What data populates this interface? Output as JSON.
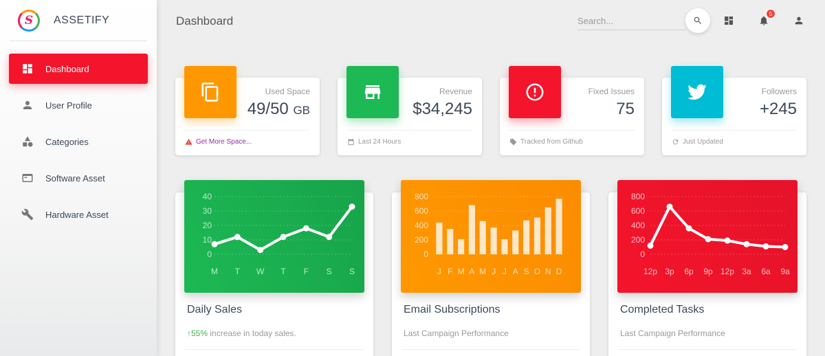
{
  "brand": {
    "name": "ASSETIFY",
    "logo_letter": "S"
  },
  "sidebar": {
    "items": [
      {
        "label": "Dashboard",
        "icon": "dashboard-icon",
        "active": true
      },
      {
        "label": "User Profile",
        "icon": "person-icon",
        "active": false
      },
      {
        "label": "Categories",
        "icon": "category-shapes-icon",
        "active": false
      },
      {
        "label": "Software Asset",
        "icon": "window-icon",
        "active": false
      },
      {
        "label": "Hardware Asset",
        "icon": "wrench-icon",
        "active": false
      }
    ]
  },
  "header": {
    "title": "Dashboard",
    "search_placeholder": "Search...",
    "notification_count": "5"
  },
  "stats": [
    {
      "label": "Used Space",
      "value": "49/50",
      "unit": "GB",
      "footer": "Get More Space...",
      "icon": "copy-icon",
      "color": "#ff9800",
      "footer_icon": "warning-icon"
    },
    {
      "label": "Revenue",
      "value": "$34,245",
      "unit": "",
      "footer": "Last 24 Hours",
      "icon": "store-icon",
      "color": "#1db954",
      "footer_icon": "calendar-icon"
    },
    {
      "label": "Fixed Issues",
      "value": "75",
      "unit": "",
      "footer": "Tracked from Github",
      "icon": "info-icon",
      "color": "#f4142b",
      "footer_icon": "tag-icon"
    },
    {
      "label": "Followers",
      "value": "+245",
      "unit": "",
      "footer": "Just Updated",
      "icon": "twitter-icon",
      "color": "#00bcd4",
      "footer_icon": "refresh-icon"
    }
  ],
  "charts": [
    {
      "title": "Daily Sales",
      "subtitle_highlight": "55%",
      "subtitle": " increase in today sales.",
      "color": "#1db954"
    },
    {
      "title": "Email Subscriptions",
      "subtitle_highlight": "",
      "subtitle": "Last Campaign Performance",
      "color": "#ff9800"
    },
    {
      "title": "Completed Tasks",
      "subtitle_highlight": "",
      "subtitle": "Last Campaign Performance",
      "color": "#f4142b"
    }
  ],
  "chart_data": [
    {
      "type": "line",
      "categories": [
        "M",
        "T",
        "W",
        "T",
        "F",
        "S",
        "S"
      ],
      "values": [
        7,
        12,
        3,
        12,
        18,
        12,
        33
      ],
      "yticks": [
        0,
        10,
        20,
        30,
        40
      ],
      "ylim": [
        0,
        40
      ],
      "grid": true
    },
    {
      "type": "bar",
      "categories": [
        "J",
        "F",
        "M",
        "A",
        "M",
        "J",
        "J",
        "A",
        "S",
        "O",
        "N",
        "D"
      ],
      "values": [
        440,
        350,
        210,
        680,
        460,
        370,
        210,
        330,
        470,
        510,
        650,
        770
      ],
      "yticks": [
        0,
        200,
        400,
        600,
        800
      ],
      "ylim": [
        0,
        800
      ],
      "grid": true
    },
    {
      "type": "line",
      "categories": [
        "12p",
        "3p",
        "6p",
        "9p",
        "12p",
        "3a",
        "6a",
        "9a"
      ],
      "values": [
        120,
        660,
        360,
        210,
        190,
        140,
        110,
        100
      ],
      "yticks": [
        0,
        200,
        400,
        600,
        800
      ],
      "ylim": [
        0,
        800
      ],
      "grid": true
    }
  ]
}
